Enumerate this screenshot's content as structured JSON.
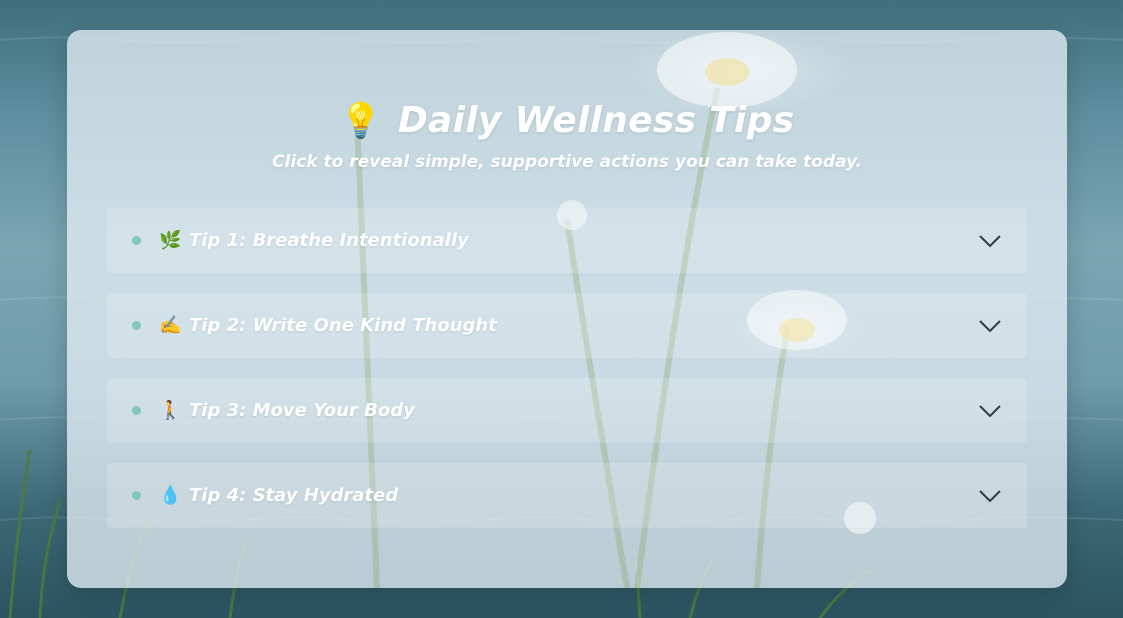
{
  "header": {
    "icon": "lightbulb-icon",
    "icon_glyph": "💡",
    "title": "Daily Wellness Tips",
    "subtitle": "Click to reveal simple, supportive actions you can take today."
  },
  "tips": [
    {
      "icon": "herb-icon",
      "icon_glyph": "🌿",
      "label": "Tip 1: Breathe Intentionally"
    },
    {
      "icon": "writing-hand-icon",
      "icon_glyph": "✍️",
      "label": "Tip 2: Write One Kind Thought"
    },
    {
      "icon": "walking-person-icon",
      "icon_glyph": "🚶",
      "label": "Tip 3: Move Your Body"
    },
    {
      "icon": "droplet-icon",
      "icon_glyph": "💧",
      "label": "Tip 4: Stay Hydrated"
    }
  ],
  "colors": {
    "bullet": "#7fc8bb",
    "text": "#ffffff",
    "chevron": "#2f3b40"
  }
}
